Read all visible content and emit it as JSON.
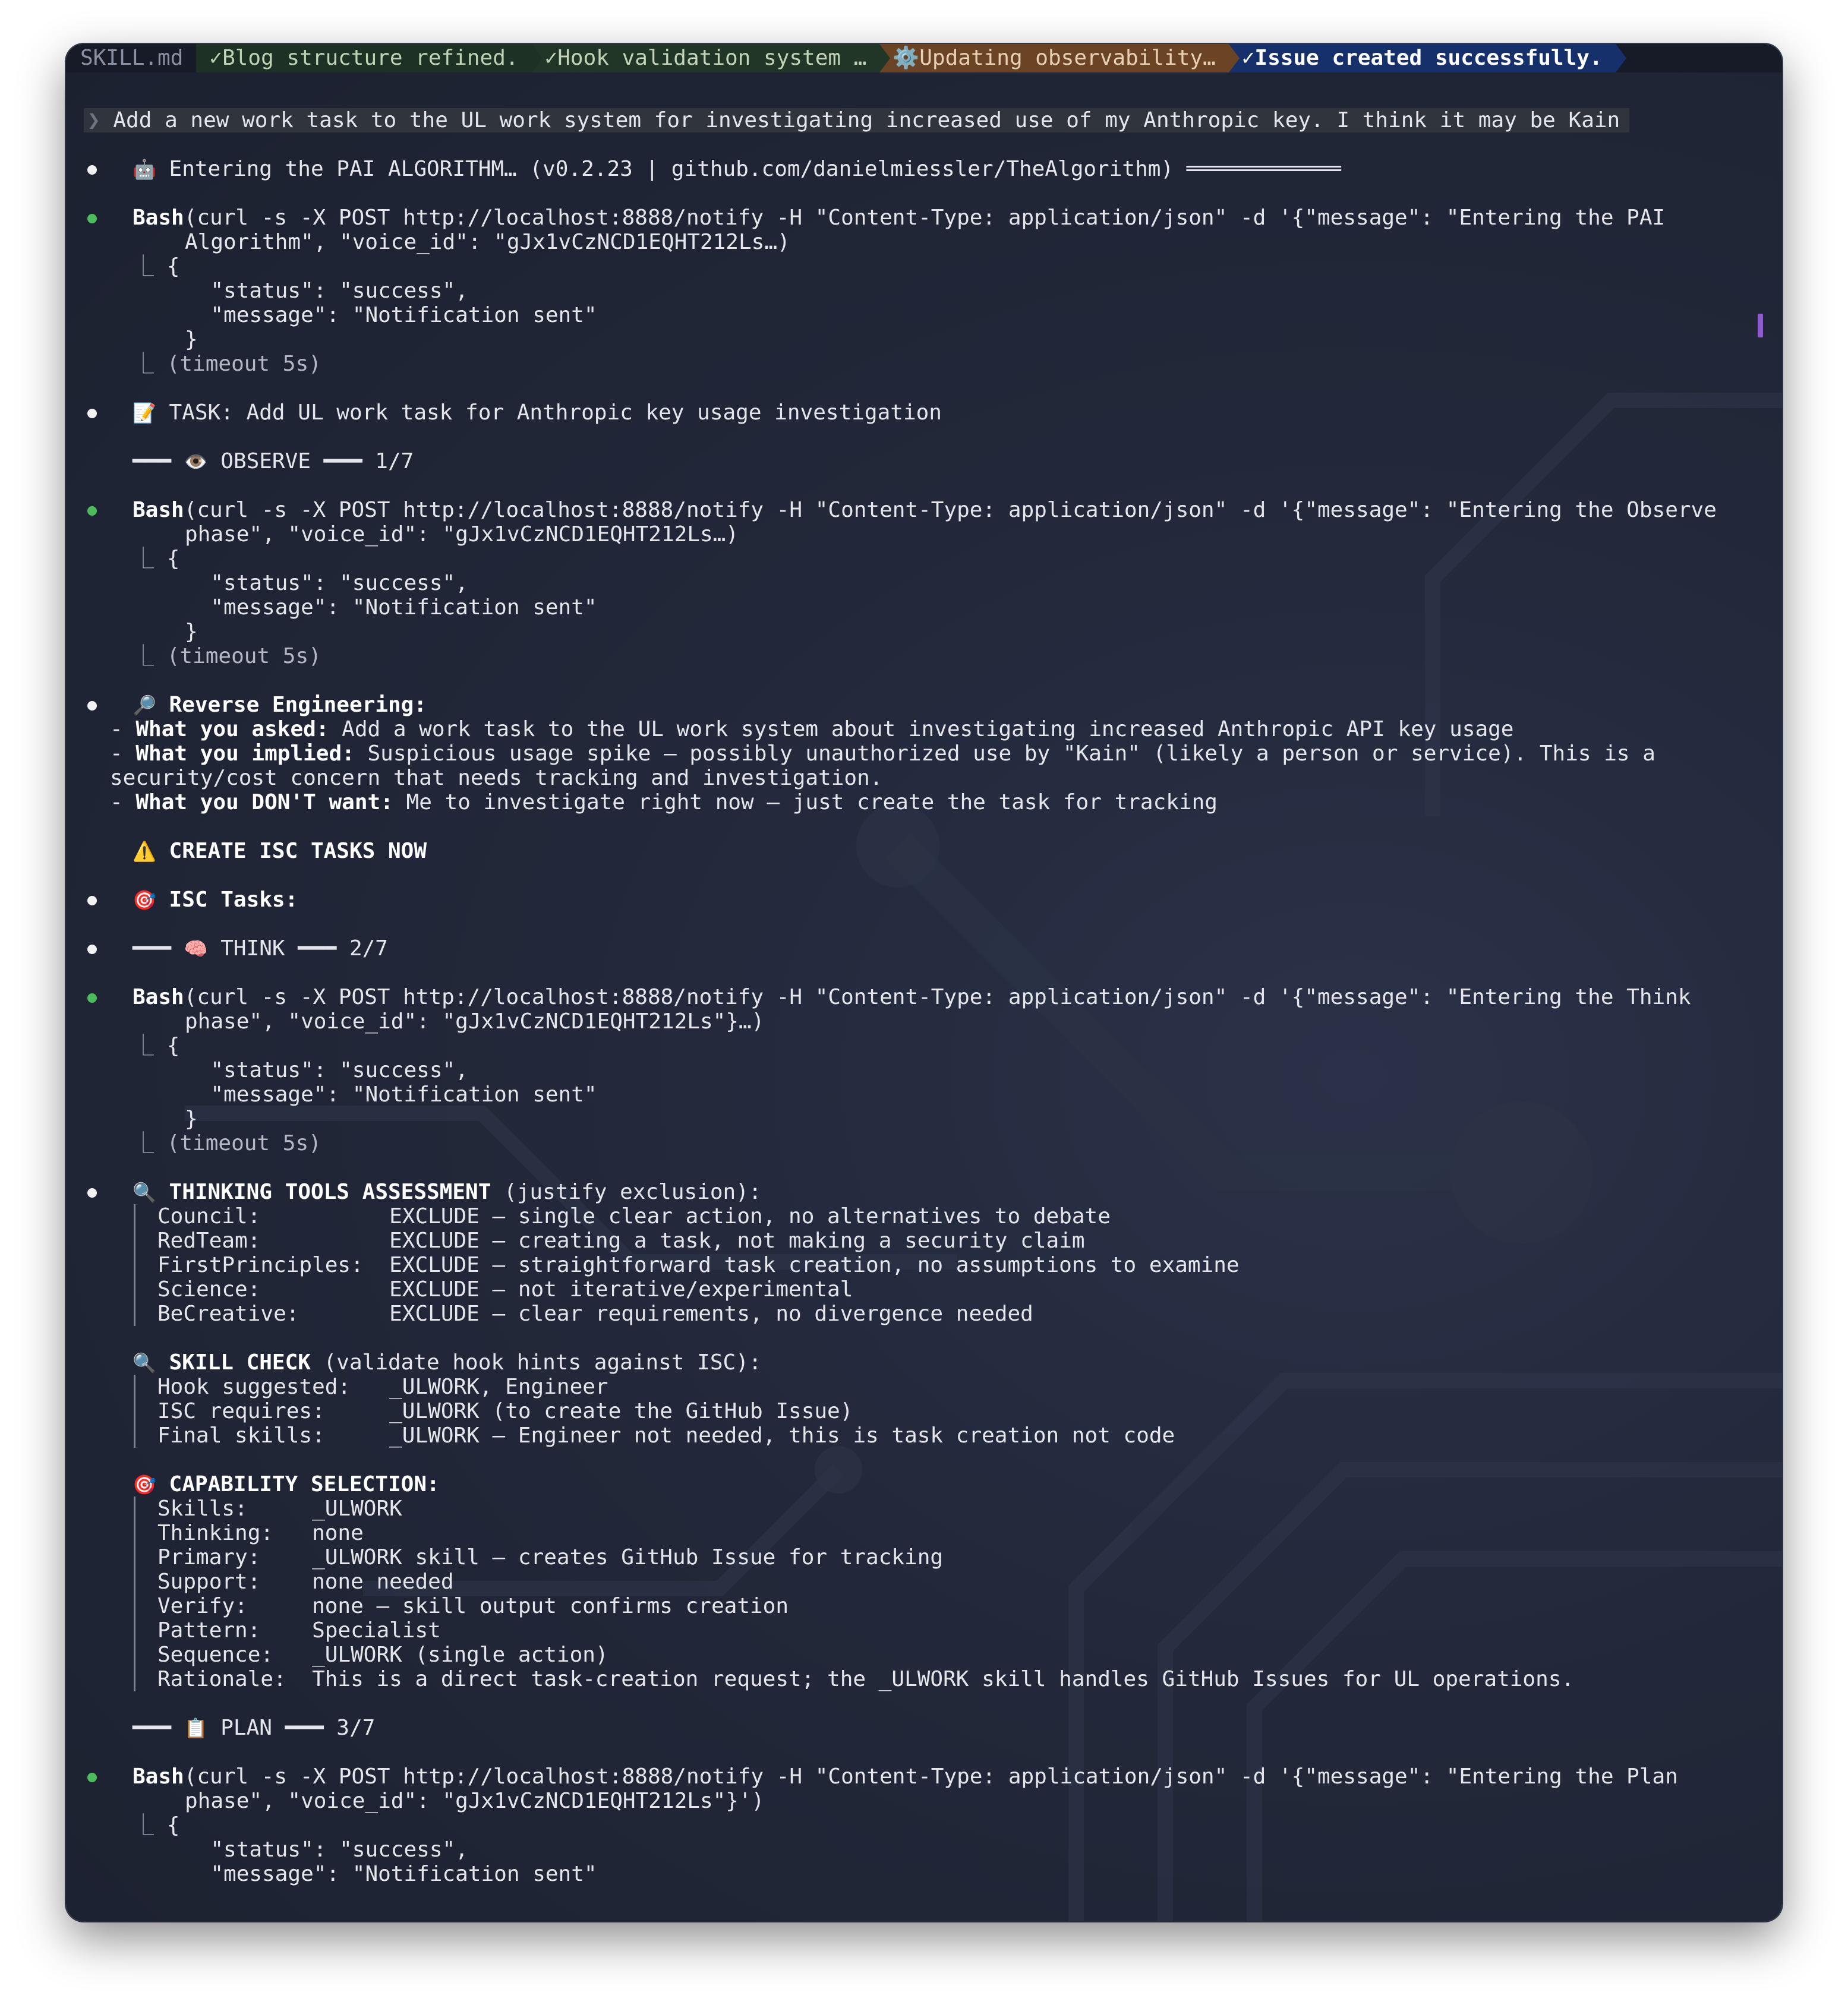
{
  "tabs": [
    {
      "label": "SKILL.md",
      "style": "plain"
    },
    {
      "label": "✓Blog structure refined.",
      "style": "green"
    },
    {
      "label": "✓Hook validation system …",
      "style": "green2"
    },
    {
      "label": "⚙️Updating observability…",
      "style": "orange"
    },
    {
      "label": "✓Issue created successfully.",
      "style": "blue"
    }
  ],
  "prompt": {
    "arrow": "❯",
    "text": "Add a new work task to the UL work system for investigating increased use of my Anthropic key. I think it may be Kain"
  },
  "entering": {
    "icon": "🤖",
    "text": "Entering the PAI ALGORITHM… (v0.2.23 | github.com/danielmiessler/TheAlgorithm) ════════════"
  },
  "bash_label": "Bash",
  "bash1": {
    "line1": "(curl -s -X POST http://localhost:8888/notify -H \"Content-Type: application/json\" -d '{\"message\": \"Entering the PAI",
    "line2": "Algorithm\", \"voice_id\": \"gJx1vCzNCD1EQHT212Ls…)"
  },
  "bash2": {
    "line1": "(curl -s -X POST http://localhost:8888/notify -H \"Content-Type: application/json\" -d '{\"message\": \"Entering the Observe",
    "line2": "phase\", \"voice_id\": \"gJx1vCzNCD1EQHT212Ls…)"
  },
  "bash3": {
    "line1": "(curl -s -X POST http://localhost:8888/notify -H \"Content-Type: application/json\" -d '{\"message\": \"Entering the Think",
    "line2": "phase\", \"voice_id\": \"gJx1vCzNCD1EQHT212Ls\"}…)"
  },
  "bash4": {
    "line1": "(curl -s -X POST http://localhost:8888/notify -H \"Content-Type: application/json\" -d '{\"message\": \"Entering the Plan",
    "line2": "phase\", \"voice_id\": \"gJx1vCzNCD1EQHT212Ls\"}')"
  },
  "response": {
    "corner": "⎿",
    "open": "{",
    "status": "\"status\": \"success\",",
    "message": "\"message\": \"Notification sent\"",
    "close": "}",
    "timeout": "(timeout 5s)"
  },
  "task": {
    "icon": "📝",
    "text": "TASK: Add UL work task for Anthropic key usage investigation"
  },
  "phases": {
    "observe": {
      "icon": "👁️",
      "pre": "━━━ ",
      "label": " OBSERVE ━━━ 1/7"
    },
    "think": {
      "icon": "🧠",
      "pre": "━━━ ",
      "label": " THINK ━━━ 2/7"
    },
    "plan": {
      "icon": "📋",
      "pre": "━━━ ",
      "label": " PLAN ━━━ 3/7"
    }
  },
  "reverse": {
    "icon": "🔎",
    "title": "Reverse Engineering:",
    "asked_label": "What you asked:",
    "asked_text": " Add a work task to the UL work system about investigating increased Anthropic API key usage",
    "implied_label": "What you implied:",
    "implied_text": " Suspicious usage spike — possibly unauthorized use by \"Kain\" (likely a person or service). This is a",
    "implied_text2": "security/cost concern that needs tracking and investigation.",
    "dont_label": "What you DON'T want:",
    "dont_text": " Me to investigate right now — just create the task for tracking",
    "dash": "- "
  },
  "create_isc": {
    "icon": "⚠️",
    "text": "CREATE ISC TASKS NOW"
  },
  "isc_tasks": {
    "icon": "🎯",
    "text": "ISC Tasks:"
  },
  "thinking_tools": {
    "icon": "🔍",
    "title": "THINKING TOOLS ASSESSMENT",
    "subtitle": " (justify exclusion):",
    "rows": [
      "Council:          EXCLUDE — single clear action, no alternatives to debate",
      "RedTeam:          EXCLUDE — creating a task, not making a security claim",
      "FirstPrinciples:  EXCLUDE — straightforward task creation, no assumptions to examine",
      "Science:          EXCLUDE — not iterative/experimental",
      "BeCreative:       EXCLUDE — clear requirements, no divergence needed"
    ]
  },
  "skill_check": {
    "icon": "🔍",
    "title": "SKILL CHECK",
    "subtitle": " (validate hook hints against ISC):",
    "rows": [
      "Hook suggested:   _ULWORK, Engineer",
      "ISC requires:     _ULWORK (to create the GitHub Issue)",
      "Final skills:     _ULWORK — Engineer not needed, this is task creation not code"
    ]
  },
  "capability": {
    "icon": "🎯",
    "title": "CAPABILITY SELECTION:",
    "rows": [
      "Skills:     _ULWORK",
      "Thinking:   none",
      "Primary:    _ULWORK skill — creates GitHub Issue for tracking",
      "Support:    none needed",
      "Verify:     none — skill output confirms creation",
      "Pattern:    Specialist",
      "Sequence:   _ULWORK (single action)",
      "Rationale:  This is a direct task-creation request; the _ULWORK skill handles GitHub Issues for UL operations."
    ]
  },
  "colors": {
    "background": "#222839",
    "green_bullet": "#4cbc5a",
    "active_tab": "#15306b",
    "scroll_marker": "#8b5cc9"
  }
}
